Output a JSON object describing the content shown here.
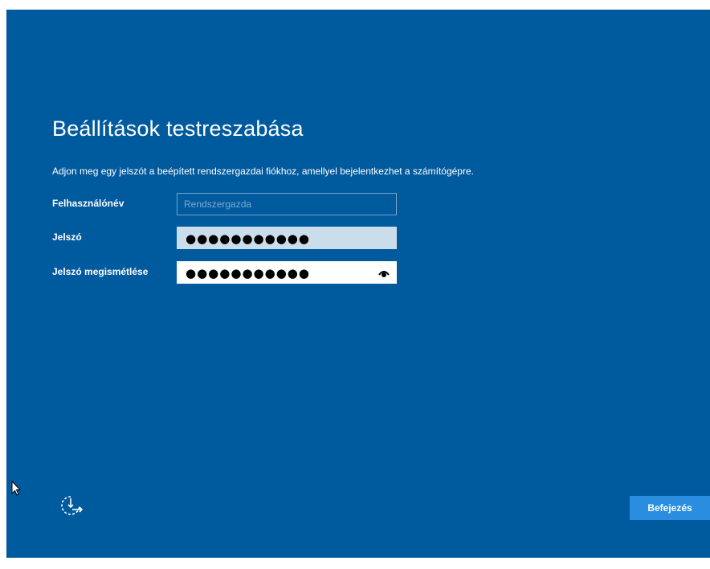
{
  "page": {
    "title": "Beállítások testreszabása",
    "subtitle": "Adjon meg egy jelszót a beépített rendszergazdai fiókhoz, amellyel bejelentkezhet a számítógépre."
  },
  "form": {
    "username_label": "Felhasználónév",
    "username_placeholder": "Rendszergazda",
    "password_label": "Jelszó",
    "password_value": "●●●●●●●●●●●",
    "confirm_label": "Jelszó megismétlése",
    "confirm_value": "●●●●●●●●●●●"
  },
  "buttons": {
    "finish_label": "Befejezés"
  },
  "icons": {
    "accessibility": "ease-of-access-icon",
    "reveal": "reveal-password-eye-icon",
    "cursor": "mouse-pointer-icon"
  },
  "colors": {
    "background": "#005a9e",
    "button": "#2a8de0",
    "password_field": "#cbdcea"
  }
}
